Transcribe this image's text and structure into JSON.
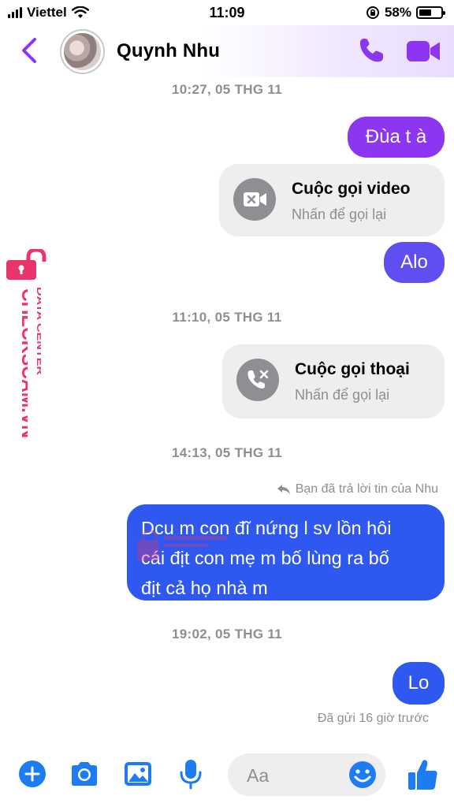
{
  "status_bar": {
    "carrier": "Viettel",
    "time": "11:09",
    "battery_percent": "58%",
    "battery_level": 0.58
  },
  "header": {
    "contact_name": "Quynh Nhu",
    "icons": [
      "chevron-left-icon",
      "phone-icon",
      "video-camera-icon"
    ],
    "accent_color": "#8c36f2"
  },
  "conversation": {
    "timestamps": [
      "10:27, 05 THG 11",
      "11:10, 05 THG 11",
      "14:13, 05 THG 11",
      "19:02, 05 THG 11"
    ],
    "msg_dua": "Đùa t à",
    "video_call": {
      "title": "Cuộc gọi video",
      "subtitle": "Nhấn để gọi lại"
    },
    "msg_alo": "Alo",
    "voice_call": {
      "title": "Cuộc gọi thoại",
      "subtitle": "Nhấn để gọi lại"
    },
    "reply_note": "Bạn đã trả lời tin của Nhu",
    "long_message_lines": [
      "Dcu m con đĩ nứng l sv lồn hôi",
      "cái địt con mẹ m bố lùng ra bố",
      "địt cả họ nhà m"
    ],
    "msg_lo": "Lo",
    "seen_status": "Đã gửi 16 giờ trước"
  },
  "watermark": {
    "brand": "CHECKSCAM.VN",
    "subtitle": "DATA CENTER",
    "color": "#e8356b"
  },
  "composer": {
    "placeholder": "Aa",
    "icons": [
      "plus-icon",
      "camera-icon",
      "image-icon",
      "microphone-icon",
      "emoji-icon",
      "thumbs-up-icon"
    ],
    "icon_color": "#1e7cf2"
  }
}
